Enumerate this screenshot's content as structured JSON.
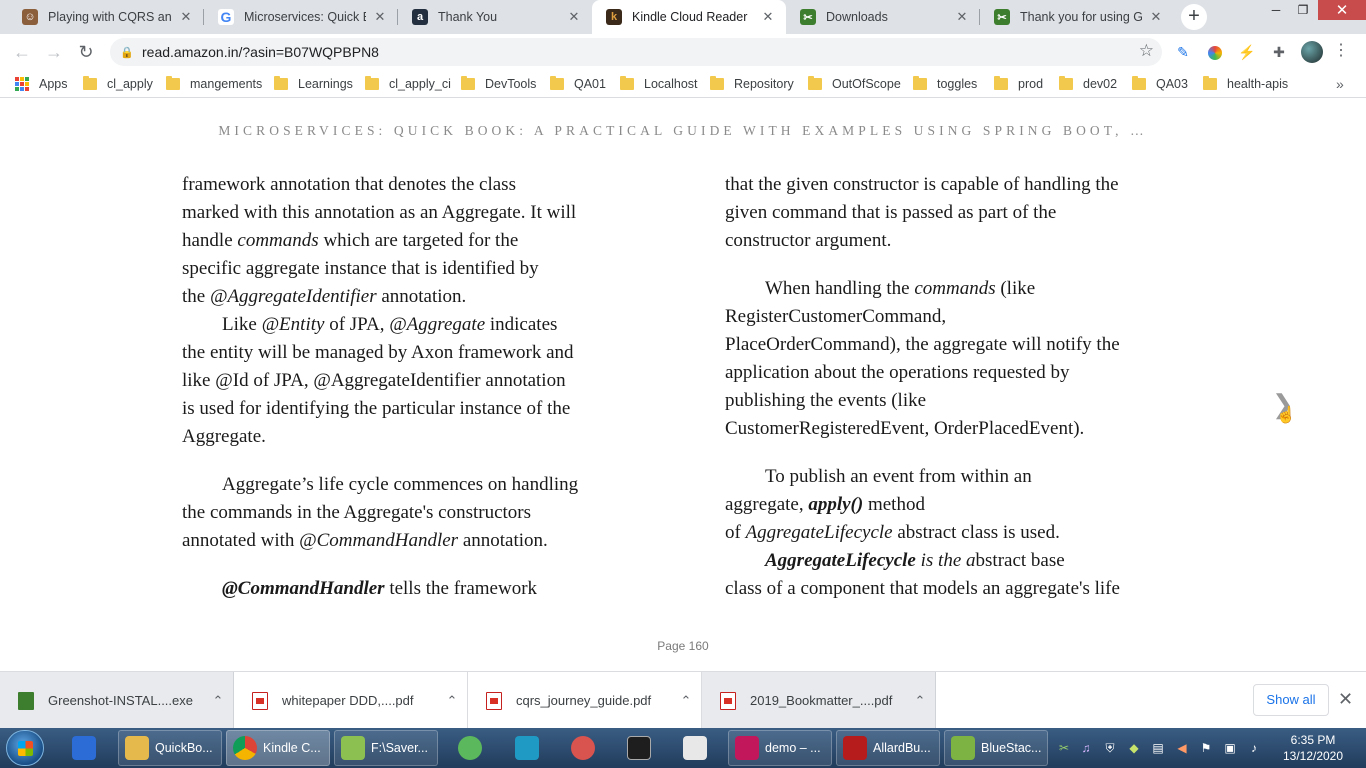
{
  "browser": {
    "tabs": [
      {
        "title": "Playing with CQRS and E",
        "icon": "avatar-favicon",
        "icon_color": "#8b5e3c",
        "active": false
      },
      {
        "title": "Microservices: Quick Boo",
        "icon": "google-icon",
        "icon_color": "#4285f4",
        "active": false
      },
      {
        "title": "Thank You",
        "icon": "amazon-icon",
        "icon_color": "#232f3e",
        "active": false
      },
      {
        "title": "Kindle Cloud Reader",
        "icon": "kindle-icon",
        "icon_color": "#c8841f",
        "active": true
      },
      {
        "title": "Downloads",
        "icon": "greenshot-icon",
        "icon_color": "#3d7d2e",
        "active": false
      },
      {
        "title": "Thank you for using Gree",
        "icon": "greenshot-icon",
        "icon_color": "#3d7d2e",
        "active": false
      }
    ],
    "new_tab_symbol": "+",
    "close_symbol": "✕",
    "window_controls": {
      "minimize": "─",
      "maximize": "❐",
      "close": "✕"
    },
    "address": "read.amazon.in/?asin=B07WQPBPN8",
    "nav": {
      "back": "←",
      "forward": "→",
      "reload": "↻"
    },
    "extensions": [
      {
        "name": "pen-extension-icon",
        "symbol": "✎",
        "color": "#1a73e8"
      },
      {
        "name": "color-wheel-extension-icon",
        "symbol": "●",
        "color": "#e8453c"
      },
      {
        "name": "bolt-extension-icon",
        "symbol": "⚡",
        "color": "#f4b400"
      },
      {
        "name": "puzzle-extensions-icon",
        "symbol": "✚",
        "color": "#5f6368"
      }
    ],
    "menu_symbol": "⋮"
  },
  "bookmarks": {
    "apps_label": "Apps",
    "items": [
      "cl_apply",
      "mangements",
      "Learnings",
      "cl_apply_ci",
      "DevTools",
      "QA01",
      "Localhost",
      "Repository",
      "OutOfScope",
      "toggles",
      "prod",
      "dev02",
      "QA03",
      "health-apis"
    ],
    "more_symbol": "»"
  },
  "reader": {
    "book_title": "MICROSERVICES: QUICK BOOK: A PRACTICAL GUIDE WITH EXAMPLES USING SPRING BOOT, …",
    "left": {
      "l1": "framework annotation that denotes the class",
      "l2": "marked with this annotation as an Aggregate. It will",
      "l3a": "handle ",
      "l3b": "commands",
      "l3c": " which are targeted for the",
      "l4": "specific aggregate instance that is identified by",
      "l5a": "the ",
      "l5b": "@AggregateIdentifier",
      "l5c": " annotation.",
      "l6a": "Like ",
      "l6b": "@Entity",
      "l6c": " of JPA, ",
      "l6d": "@Aggregate",
      "l6e": " indicates",
      "l7": "the entity will be managed by Axon framework and",
      "l8": "like @Id of JPA, @AggregateIdentifier annotation",
      "l9": "is used for identifying the particular instance of the",
      "l10": "Aggregate.",
      "l11": "Aggregate’s life cycle commences on handling",
      "l12": "the commands in the Aggregate's constructors",
      "l13a": "annotated with ",
      "l13b": "@CommandHandler",
      "l13c": " annotation.",
      "l14a": "@CommandHandler",
      "l14b": " tells the framework"
    },
    "right": {
      "r1": "that the given constructor is capable of handling the",
      "r2": "given command that is passed as part of the",
      "r3": "constructor argument.",
      "r4a": "When handling the ",
      "r4b": "commands",
      "r4c": " (like",
      "r5": "RegisterCustomerCommand,",
      "r6": "PlaceOrderCommand), the aggregate will notify the",
      "r7": "application about the operations requested by",
      "r8": "publishing the events (like",
      "r9": "CustomerRegisteredEvent, OrderPlacedEvent).",
      "r10": "To publish an event from within an",
      "r11a": "aggregate, ",
      "r11b": "apply()",
      "r11c": " method",
      "r12a": "of ",
      "r12b": "AggregateLifecycle",
      "r12c": " abstract class is used.",
      "r13a": "AggregateLifecycle",
      "r13b": " is the a",
      "r13c": "bstract base",
      "r14": "class of a component that models an aggregate's life"
    },
    "next_arrow": "❯",
    "page_label": "Page 160"
  },
  "downloads": {
    "items": [
      {
        "name": "Greenshot-INSTAL....exe",
        "type": "exe"
      },
      {
        "name": "whitepaper DDD,....pdf",
        "type": "pdf"
      },
      {
        "name": "cqrs_journey_guide.pdf",
        "type": "pdf"
      },
      {
        "name": "2019_Bookmatter_....pdf",
        "type": "pdf"
      }
    ],
    "chevron": "⌃",
    "show_all": "Show all",
    "close_symbol": "✕"
  },
  "taskbar": {
    "items": [
      {
        "label": "",
        "icon": "wps-writer-icon",
        "color": "#2b6cd6"
      },
      {
        "label": "QuickBo...",
        "icon": "folder-icon",
        "color": "#e6b94d"
      },
      {
        "label": "Kindle C...",
        "icon": "chrome-icon",
        "color": "#db4437"
      },
      {
        "label": "F:\\Saver...",
        "icon": "notepad-icon",
        "color": "#8cc152"
      },
      {
        "label": "",
        "icon": "clock-app-icon",
        "color": "#5cb85c"
      },
      {
        "label": "",
        "icon": "editor-app-icon",
        "color": "#1f9ac5"
      },
      {
        "label": "",
        "icon": "snipping-tool-icon",
        "color": "#d9534f"
      },
      {
        "label": "",
        "icon": "command-prompt-icon",
        "color": "#1e1e1e"
      },
      {
        "label": "",
        "icon": "document-app-icon",
        "color": "#e8e8e8"
      },
      {
        "label": "demo – ...",
        "icon": "intellij-icon",
        "color": "#c2185b"
      },
      {
        "label": "AllardBu...",
        "icon": "acrobat-pdf-icon",
        "color": "#b71c1c"
      },
      {
        "label": "BlueStac...",
        "icon": "bluestacks-icon",
        "color": "#7cb342"
      }
    ],
    "time": "6:35 PM",
    "date": "13/12/2020"
  }
}
